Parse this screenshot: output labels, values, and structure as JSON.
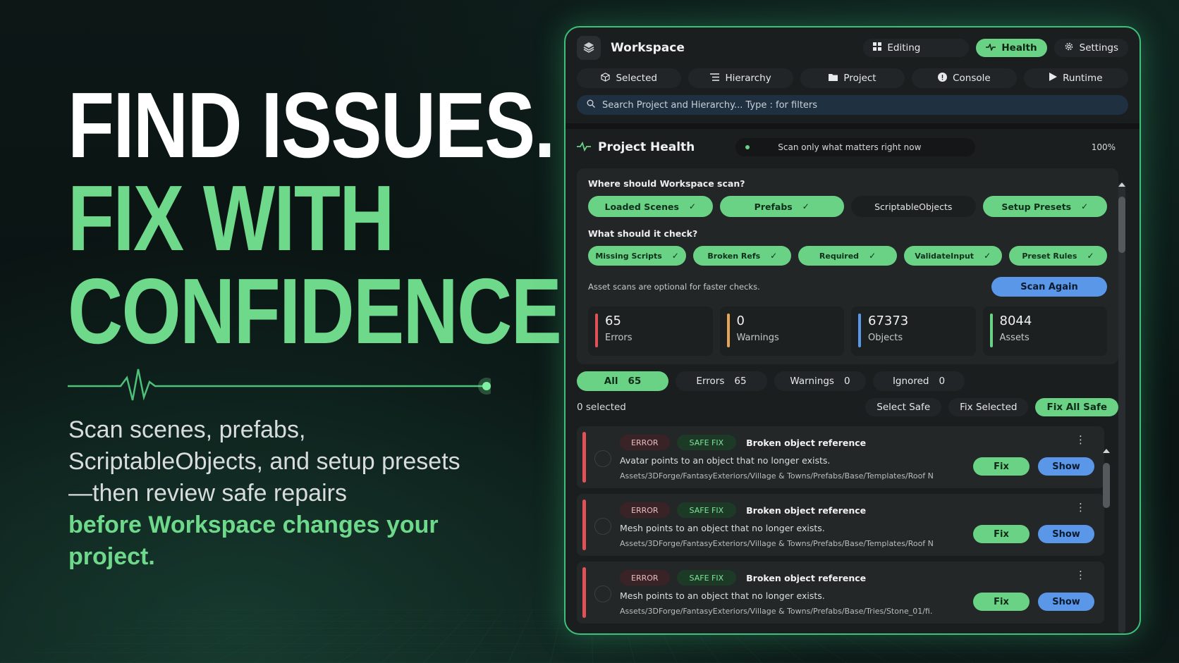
{
  "hero": {
    "line1": "FIND ISSUES.",
    "line2": "FIX WITH",
    "line3": "CONFIDENCE.",
    "body": "Scan scenes, prefabs, ScriptableObjects, and setup presets—then review safe repairs",
    "highlight": "before Workspace changes your project."
  },
  "colors": {
    "accent": "#6ad285",
    "blue": "#5b97e8",
    "error": "#e05257",
    "warning": "#e3a553"
  },
  "window": {
    "title": "Workspace",
    "top_buttons": [
      {
        "label": "Editing",
        "icon": "grid-icon"
      },
      {
        "label": "Health",
        "icon": "pulse-icon"
      },
      {
        "label": "Settings",
        "icon": "gear-icon"
      }
    ],
    "tabs": [
      {
        "label": "Selected",
        "icon": "cube-icon"
      },
      {
        "label": "Hierarchy",
        "icon": "list-icon"
      },
      {
        "label": "Project",
        "icon": "folder-icon"
      },
      {
        "label": "Console",
        "icon": "alert-icon"
      },
      {
        "label": "Runtime",
        "icon": "play-icon"
      }
    ],
    "search_placeholder": "Search Project and Hierarchy...  Type : for filters"
  },
  "health": {
    "title": "Project Health",
    "hint": "Scan only what matters right now",
    "percent": "100%",
    "scan_question": "Where should Workspace scan?",
    "scan_targets": [
      {
        "label": "Loaded Scenes",
        "on": true
      },
      {
        "label": "Prefabs",
        "on": true
      },
      {
        "label": "ScriptableObjects",
        "on": false
      },
      {
        "label": "Setup Presets",
        "on": true
      }
    ],
    "check_question": "What should it check?",
    "checks": [
      {
        "label": "Missing Scripts",
        "on": true
      },
      {
        "label": "Broken Refs",
        "on": true
      },
      {
        "label": "Required",
        "on": true
      },
      {
        "label": "ValidateInput",
        "on": true
      },
      {
        "label": "Preset Rules",
        "on": true
      }
    ],
    "optional_note": "Asset scans are optional for faster checks.",
    "scan_again": "Scan Again",
    "stats": [
      {
        "value": "65",
        "label": "Errors",
        "color": "#e05257"
      },
      {
        "value": "0",
        "label": "Warnings",
        "color": "#e3a553"
      },
      {
        "value": "67373",
        "label": "Objects",
        "color": "#5b97e8"
      },
      {
        "value": "8044",
        "label": "Assets",
        "color": "#6ad285"
      }
    ],
    "filters": [
      {
        "label": "All",
        "count": "65"
      },
      {
        "label": "Errors",
        "count": "65"
      },
      {
        "label": "Warnings",
        "count": "0"
      },
      {
        "label": "Ignored",
        "count": "0"
      }
    ],
    "selected_count": "0 selected",
    "select_safe": "Select Safe",
    "fix_selected": "Fix Selected",
    "fix_all_safe": "Fix All Safe",
    "issues": [
      {
        "badge": "ERROR",
        "safe": "SAFE FIX",
        "title": "Broken object reference",
        "desc": "Avatar points to an object that no longer exists.",
        "path": "Assets/3DForge/FantasyExteriors/Village & Towns/Prefabs/Base/Templates/Roof N",
        "fix": "Fix",
        "show": "Show"
      },
      {
        "badge": "ERROR",
        "safe": "SAFE FIX",
        "title": "Broken object reference",
        "desc": "Mesh points to an object that no longer exists.",
        "path": "Assets/3DForge/FantasyExteriors/Village & Towns/Prefabs/Base/Templates/Roof N",
        "fix": "Fix",
        "show": "Show"
      },
      {
        "badge": "ERROR",
        "safe": "SAFE FIX",
        "title": "Broken object reference",
        "desc": "Mesh points to an object that no longer exists.",
        "path": "Assets/3DForge/FantasyExteriors/Village & Towns/Prefabs/Base/Tries/Stone_01/fi.",
        "fix": "Fix",
        "show": "Show"
      }
    ]
  }
}
